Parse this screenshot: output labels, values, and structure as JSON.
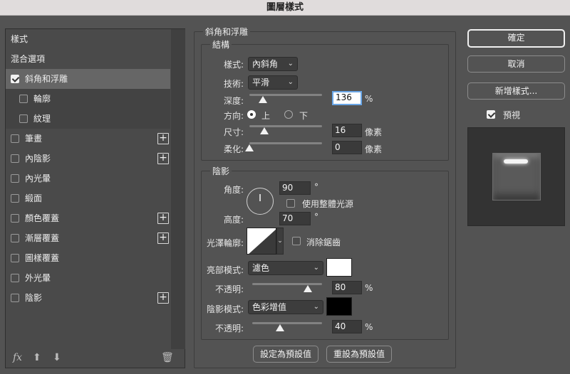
{
  "window": {
    "title": "圖層樣式"
  },
  "left_panel": {
    "items": [
      {
        "label": "樣式"
      },
      {
        "label": "混合選項"
      },
      {
        "label": "斜角和浮雕",
        "checked": true
      },
      {
        "label": "輪廓",
        "checked": false
      },
      {
        "label": "紋理",
        "checked": false
      },
      {
        "label": "筆畫",
        "checked": false,
        "plus": "+"
      },
      {
        "label": "內陰影",
        "checked": false,
        "plus": "+"
      },
      {
        "label": "內光暈",
        "checked": false
      },
      {
        "label": "緞面",
        "checked": false
      },
      {
        "label": "顏色覆蓋",
        "checked": false,
        "plus": "+"
      },
      {
        "label": "漸層覆蓋",
        "checked": false,
        "plus": "+"
      },
      {
        "label": "圖樣覆蓋",
        "checked": false
      },
      {
        "label": "外光暈",
        "checked": false
      },
      {
        "label": "陰影",
        "checked": false,
        "plus": "+"
      }
    ],
    "footer": {
      "fx": "fx",
      "up": "⬆",
      "down": "⬇",
      "trash": "🗑"
    }
  },
  "bevel": {
    "section_title": "斜角和浮雕",
    "structure": {
      "title": "結構",
      "style_label": "樣式:",
      "style_value": "內斜角",
      "technique_label": "技術:",
      "technique_value": "平滑",
      "depth_label": "深度:",
      "depth_value": "136",
      "depth_unit": "%",
      "depth_slider": 0.136,
      "direction_label": "方向:",
      "dir_up": "上",
      "dir_down": "下",
      "direction_selected": "上",
      "size_label": "尺寸:",
      "size_value": "16",
      "size_unit": "像素",
      "size_slider": 0.16,
      "soften_label": "柔化:",
      "soften_value": "0",
      "soften_unit": "像素",
      "soften_slider": 0.0
    },
    "shading": {
      "title": "陰影",
      "angle_label": "角度:",
      "angle_value": "90",
      "angle_unit": "°",
      "global_light_label": "使用整體光源",
      "global_light_checked": false,
      "altitude_label": "高度:",
      "altitude_value": "70",
      "altitude_unit": "°",
      "gloss_label": "光澤輪廓:",
      "antialias_label": "消除鋸齒",
      "antialias_checked": false,
      "highlight_mode_label": "亮部模式:",
      "highlight_mode_value": "濾色",
      "highlight_color": "#ffffff",
      "highlight_opacity_label": "不透明:",
      "highlight_opacity_value": "80",
      "highlight_opacity_unit": "%",
      "highlight_opacity_slider": 0.8,
      "shadow_mode_label": "陰影模式:",
      "shadow_mode_value": "色彩增值",
      "shadow_color": "#000000",
      "shadow_opacity_label": "不透明:",
      "shadow_opacity_value": "40",
      "shadow_opacity_unit": "%",
      "shadow_opacity_slider": 0.4
    },
    "make_default": "設定為預設值",
    "reset_default": "重設為預設值"
  },
  "right": {
    "ok": "確定",
    "cancel": "取消",
    "new_style": "新增樣式...",
    "preview_label": "預視",
    "preview_checked": true
  }
}
